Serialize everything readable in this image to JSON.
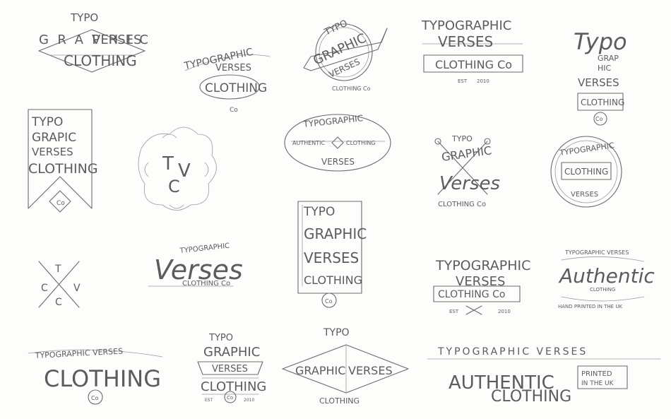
{
  "sketches": {
    "s1": {
      "l1": "TYPO",
      "l2": "GRAPHIC",
      "l3": "VERSES",
      "l4": "CLOTHING"
    },
    "s2": {
      "l1": "TYPOGRAPHIC",
      "l2": "VERSES",
      "l3": "CLOTHING",
      "l4": "Co"
    },
    "s3": {
      "l1": "TYPO",
      "l2": "GRAPHIC",
      "l3": "VERSES",
      "l4": "CLOTHING Co"
    },
    "s4": {
      "l1": "TYPOGRAPHIC",
      "l2": "VERSES",
      "l3": "CLOTHING Co",
      "l4": "EST",
      "l5": "2010"
    },
    "s5": {
      "l1": "Typo",
      "l2": "GRAP",
      "l3": "HIC",
      "l4": "VERSES",
      "l5": "CLOTHING",
      "l6": "Co"
    },
    "s6": {
      "l1": "TYPO",
      "l2": "GRAPIC",
      "l3": "VERSES",
      "l4": "CLOTHING",
      "l5": "Co"
    },
    "s7": {
      "l1": "T",
      "l2": "V",
      "l3": "C"
    },
    "s8": {
      "l1": "TYPOGRAPHIC",
      "l2": "AUTHENTIC",
      "l3": "CLOTHING",
      "l4": "VERSES"
    },
    "s9": {
      "l1": "TYPO",
      "l2": "GRAPHIC",
      "l3": "Verses",
      "l4": "CLOTHING Co"
    },
    "s10": {
      "l1": "TYPOGRAPHIC",
      "l2": "CLOTHING",
      "l3": "VERSES"
    },
    "s11": {
      "l1": "T",
      "l2": "C",
      "l3": "V",
      "l4": "C"
    },
    "s12": {
      "l1": "TYPOGRAPHIC",
      "l2": "Verses",
      "l3": "CLOTHING Co"
    },
    "s13": {
      "l1": "TYPO",
      "l2": "GRAPHIC",
      "l3": "VERSES",
      "l4": "CLOTHING",
      "l5": "Co"
    },
    "s14": {
      "l1": "TYPOGRAPHIC",
      "l2": "VERSES",
      "l3": "CLOTHING Co",
      "l4": "EST",
      "l5": "2010"
    },
    "s15": {
      "l1": "TYPOGRAPHIC VERSES",
      "l2": "Authentic",
      "l3": "CLOTHING",
      "l4": "HAND PRINTED IN THE UK"
    },
    "s16": {
      "l1": "TYPOGRAPHIC VERSES",
      "l2": "CLOTHING",
      "l3": "Co"
    },
    "s17": {
      "l1": "TYPO",
      "l2": "GRAPHIC",
      "l3": "VERSES",
      "l4": "CLOTHING",
      "l5": "Co",
      "l6": "EST",
      "l7": "2010"
    },
    "s18": {
      "l1": "TYPO",
      "l2": "GRAPHIC",
      "l3": "VERSES",
      "l4": "CLOTHING"
    },
    "s19": {
      "l1": "TYPOGRAPHIC VERSES",
      "l2": "AUTHENTIC",
      "l3": "CLOTHING",
      "l4": "PRINTED",
      "l5": "IN THE UK"
    }
  }
}
